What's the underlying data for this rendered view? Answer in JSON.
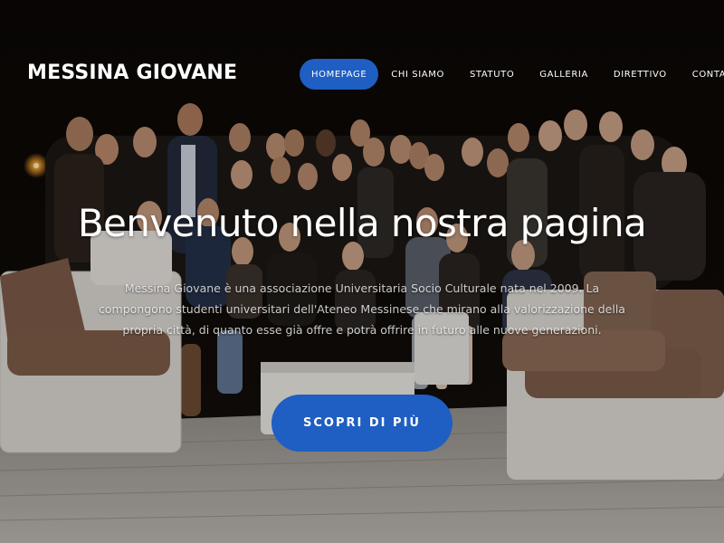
{
  "brand": {
    "name": "MESSINA GIOVANE"
  },
  "nav": {
    "items": [
      {
        "label": "HOMEPAGE",
        "active": true
      },
      {
        "label": "CHI SIAMO",
        "active": false
      },
      {
        "label": "STATUTO",
        "active": false
      },
      {
        "label": "GALLERIA",
        "active": false
      },
      {
        "label": "DIRETTIVO",
        "active": false
      },
      {
        "label": "CONTATTI",
        "active": false
      }
    ]
  },
  "hero": {
    "title": "Benvenuto nella nostra pagina",
    "description": "Messina Giovane è una associazione Universitaria Socio Culturale nata nel 2009. La compongono studenti universitari dell'Ateneo Messinese che mirano alla valorizzazione della propria città, di quanto esse già offre e potrà offrire in futuro alle nuove generazioni.",
    "cta_label": "SCOPRI DI PIÙ"
  },
  "colors": {
    "accent": "#1f5ec2",
    "text": "#ffffff",
    "background": "#0b0806"
  }
}
